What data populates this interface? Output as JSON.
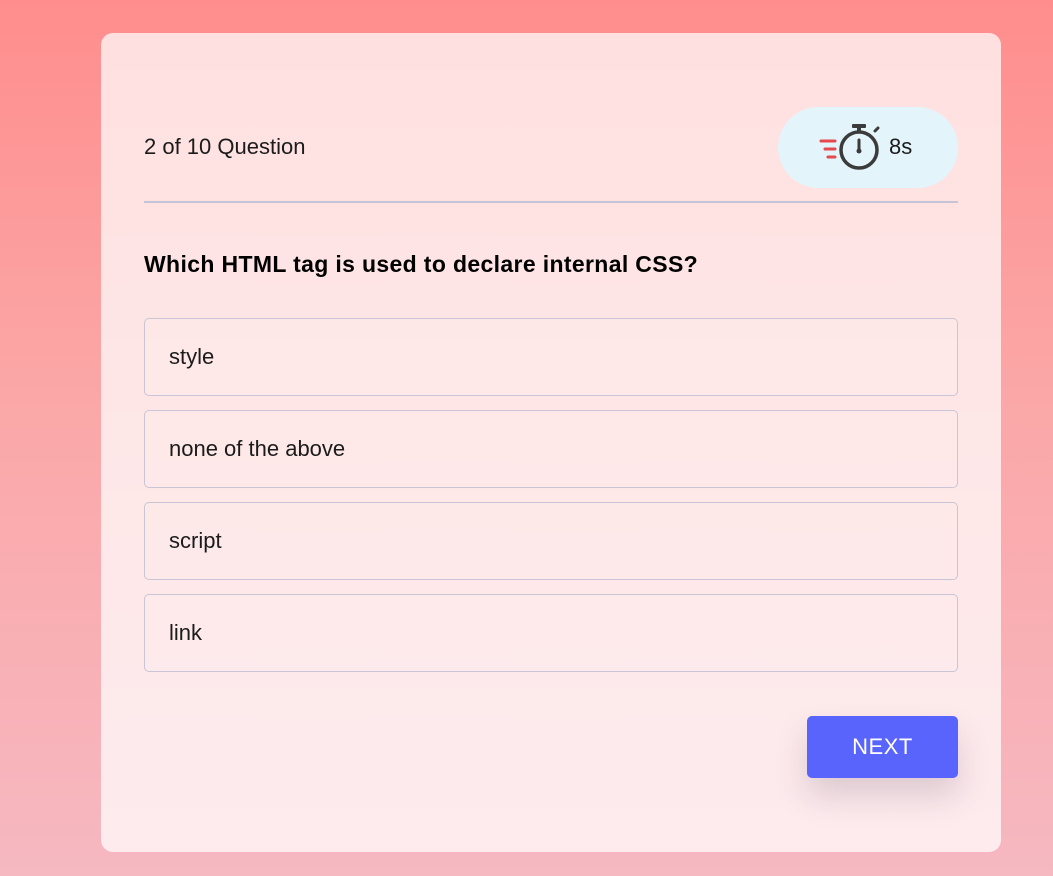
{
  "quiz": {
    "counter_text": "2 of 10 Question",
    "timer": {
      "value": "8s",
      "icon": "stopwatch-icon",
      "accent_color": "#e5484d"
    },
    "question": "Which HTML tag is used to declare internal CSS?",
    "options": [
      {
        "label": "style"
      },
      {
        "label": "none of the above"
      },
      {
        "label": "script"
      },
      {
        "label": "link"
      }
    ],
    "next_label": "NEXT"
  },
  "colors": {
    "background_top": "#ff8d8d",
    "background_bottom": "#f6b8c1",
    "button": "#5864fb",
    "timer_pill": "#e4f4fb",
    "divider": "#c6c3d6"
  }
}
